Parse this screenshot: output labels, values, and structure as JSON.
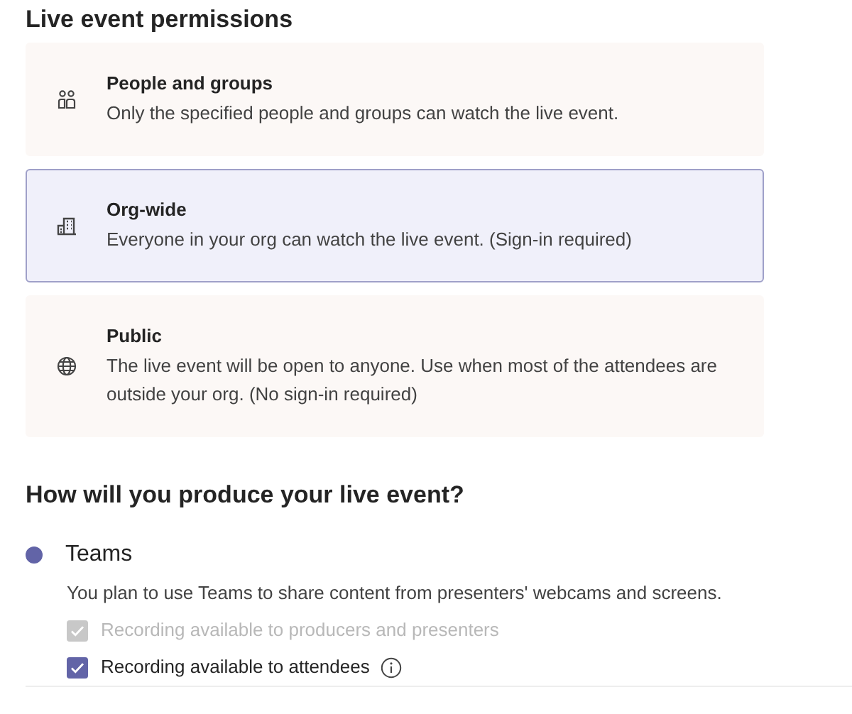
{
  "permissions": {
    "title": "Live event permissions",
    "options": [
      {
        "kind": "people",
        "label": "People and groups",
        "description": "Only the specified people and groups can watch the live event.",
        "selected": false
      },
      {
        "kind": "org",
        "label": "Org-wide",
        "description": "Everyone in your org can watch the live event. (Sign-in required)",
        "selected": true
      },
      {
        "kind": "public",
        "label": "Public",
        "description": "The live event will be open to anyone. Use when most of the attendees are outside your org. (No sign-in required)",
        "selected": false
      }
    ]
  },
  "production": {
    "title": "How will you produce your live event?",
    "option": {
      "label": "Teams",
      "selected": true,
      "description": "You plan to use Teams to share content from presenters' webcams and screens."
    },
    "checkboxes": [
      {
        "label": "Recording available to producers and presenters",
        "checked": true,
        "disabled": true,
        "info": false
      },
      {
        "label": "Recording available to attendees",
        "checked": true,
        "disabled": false,
        "info": true
      }
    ]
  }
}
